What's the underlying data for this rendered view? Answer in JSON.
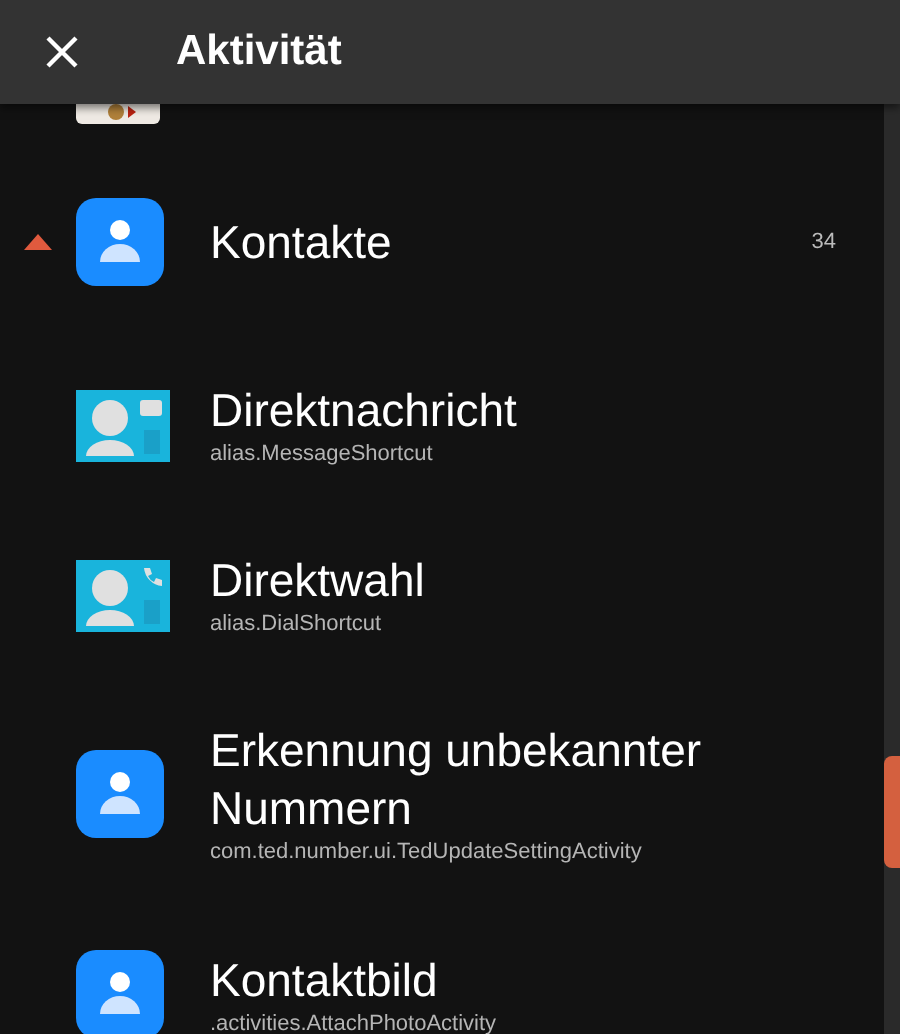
{
  "window": {
    "title": "Aktivität"
  },
  "rows": [
    {
      "kind": "partial"
    },
    {
      "kind": "app",
      "title": "Kontakte",
      "count": "34",
      "expanded": true
    },
    {
      "kind": "message-shortcut",
      "title": "Direktnachricht",
      "subtitle": "alias.MessageShortcut"
    },
    {
      "kind": "dial-shortcut",
      "title": "Direktwahl",
      "subtitle": "alias.DialShortcut"
    },
    {
      "kind": "activity",
      "title": "Erkennung unbekannter Nummern",
      "subtitle": "com.ted.number.ui.TedUpdateSettingActivity"
    },
    {
      "kind": "activity",
      "title": "Kontaktbild",
      "subtitle": ".activities.AttachPhotoActivity"
    }
  ]
}
